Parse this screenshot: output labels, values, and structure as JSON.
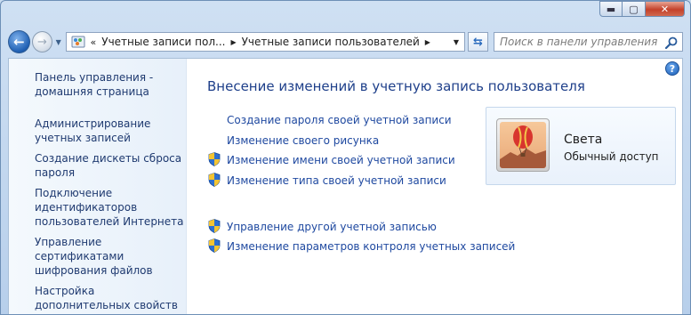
{
  "window": {
    "controls": {
      "minimize": "▬",
      "maximize": "▢",
      "close": "✕"
    }
  },
  "navbar": {
    "address": {
      "chevron": "«",
      "crumbs": [
        "Учетные записи пол...",
        "Учетные записи пользователей"
      ]
    },
    "search": {
      "placeholder": "Поиск в панели управления"
    }
  },
  "sidebar": {
    "home": "Панель управления - домашняя страница",
    "links": [
      "Администрирование учетных записей",
      "Создание дискеты сброса пароля",
      "Подключение идентификаторов пользователей Интернета",
      "Управление сертификатами шифрования файлов",
      "Настройка дополнительных свойств профиля пользователя"
    ]
  },
  "main": {
    "title": "Внесение изменений в учетную запись пользователя",
    "tasks": [
      {
        "label": "Создание пароля своей учетной записи",
        "shield": false
      },
      {
        "label": "Изменение своего рисунка",
        "shield": false
      },
      {
        "label": "Изменение имени своей учетной записи",
        "shield": true
      },
      {
        "label": "Изменение типа своей учетной записи",
        "shield": true
      }
    ],
    "other_tasks": [
      {
        "label": "Управление другой учетной записью",
        "shield": true
      },
      {
        "label": "Изменение параметров контроля учетных записей",
        "shield": true
      }
    ],
    "user": {
      "name": "Света",
      "type": "Обычный доступ"
    }
  },
  "colors": {
    "link": "#1f49a0",
    "title": "#1e3f8a",
    "sidebar_link": "#1f3a70"
  },
  "icons": [
    "back-arrow-icon",
    "forward-arrow-icon",
    "control-panel-icon",
    "refresh-icon",
    "search-icon",
    "help-icon",
    "uac-shield-icon",
    "balloon-avatar"
  ]
}
